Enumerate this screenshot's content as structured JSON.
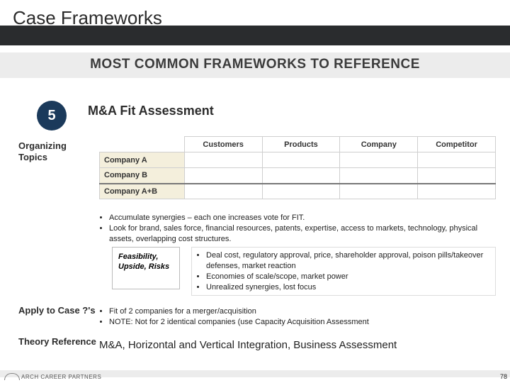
{
  "title": "Case Frameworks",
  "subtitle": "MOST COMMON FRAMEWORKS TO REFERENCE",
  "framework": {
    "number": "5",
    "name": "M&A Fit Assessment"
  },
  "left_labels": {
    "organizing": "Organizing Topics",
    "apply": "Apply to Case ?'s",
    "theory": "Theory Reference"
  },
  "matrix": {
    "cols": [
      "Customers",
      "Products",
      "Company",
      "Competitor"
    ],
    "rows": [
      "Company A",
      "Company B",
      "Company A+B"
    ]
  },
  "synergy_bullets": [
    "Accumulate synergies – each one increases vote for FIT.",
    "Look for brand, sales force, financial resources, patents, expertise, access to markets, technology, physical assets, overlapping cost structures."
  ],
  "feasibility": {
    "label": "Feasibility, Upside, Risks",
    "items": [
      "Deal cost, regulatory approval, price, shareholder approval, poison pills/takeover defenses, market reaction",
      "Economies of scale/scope, market power",
      "Unrealized synergies, lost focus"
    ]
  },
  "apply_bullets": [
    "Fit of 2 companies for a merger/acquisition",
    "NOTE: Not for 2 identical companies (use Capacity Acquisition Assessment"
  ],
  "theory_text": "M&A, Horizontal and Vertical Integration, Business Assessment",
  "footer": {
    "logo": "ARCH CAREER PARTNERS",
    "page": "78"
  }
}
